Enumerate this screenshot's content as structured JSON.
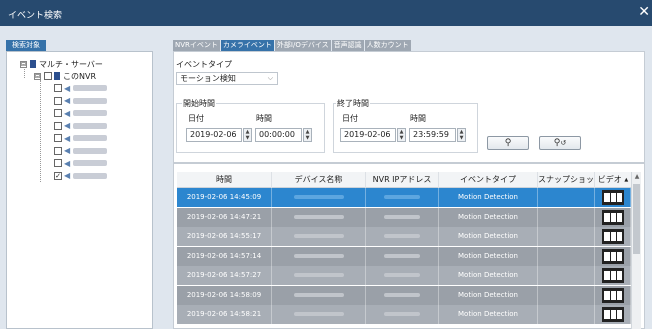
{
  "window": {
    "title": "イベント検索",
    "close_icon": "✕"
  },
  "left_panel": {
    "tab_label": "検索対象",
    "root_label": "マルチ・サーバー",
    "root_expand": "⊟",
    "server_label": "このNVR",
    "server_expand": "⊟",
    "cameras": [
      {
        "checked": false,
        "check_mark": ""
      },
      {
        "checked": false,
        "check_mark": ""
      },
      {
        "checked": false,
        "check_mark": ""
      },
      {
        "checked": false,
        "check_mark": ""
      },
      {
        "checked": false,
        "check_mark": ""
      },
      {
        "checked": false,
        "check_mark": ""
      },
      {
        "checked": false,
        "check_mark": ""
      },
      {
        "checked": true,
        "check_mark": "✓"
      }
    ]
  },
  "tabs": [
    {
      "label": "NVRイベント",
      "active": false
    },
    {
      "label": "カメライベント",
      "active": true
    },
    {
      "label": "外部I/Oデバイス",
      "active": false
    },
    {
      "label": "音声認識",
      "active": false
    },
    {
      "label": "人数カウント",
      "active": false
    }
  ],
  "filter": {
    "event_type_label": "イベントタイプ",
    "event_type_value": "モーション検知",
    "event_type_arrow": "⌵",
    "start": {
      "label": "開始時間",
      "date_label": "日付",
      "time_label": "時間",
      "date": "2019-02-06",
      "time": "00:00:00"
    },
    "end": {
      "label": "終了時間",
      "date_label": "日付",
      "time_label": "時間",
      "date": "2019-02-06",
      "time": "23:59:59"
    },
    "spin_up": "▲",
    "spin_down": "▼",
    "search_icon": "⚲",
    "search_image_icon": "⚲",
    "search_image_badge": "↺"
  },
  "table": {
    "headers": [
      "時間",
      "デバイス名称",
      "NVR IPアドレス",
      "イベントタイプ",
      "スナップショット",
      "ビデオ"
    ],
    "rows": [
      {
        "time": "2019-02-06 14:45:09",
        "event": "Motion Detection",
        "selected": true
      },
      {
        "time": "2019-02-06 14:47:21",
        "event": "Motion Detection",
        "selected": false
      },
      {
        "time": "2019-02-06 14:55:17",
        "event": "Motion Detection",
        "selected": false
      },
      {
        "time": "2019-02-06 14:57:14",
        "event": "Motion Detection",
        "selected": false
      },
      {
        "time": "2019-02-06 14:57:27",
        "event": "Motion Detection",
        "selected": false
      },
      {
        "time": "2019-02-06 14:58:09",
        "event": "Motion Detection",
        "selected": false
      },
      {
        "time": "2019-02-06 14:58:21",
        "event": "Motion Detection",
        "selected": false
      }
    ],
    "sort_icon": "▲",
    "scroll_up": "▲"
  },
  "colors": {
    "titlebar": "#274a6f",
    "accent": "#3672a9",
    "row_selected": "#2c86cf",
    "row_dark": "#9aa0a8",
    "row_light": "#a8aeb6"
  }
}
